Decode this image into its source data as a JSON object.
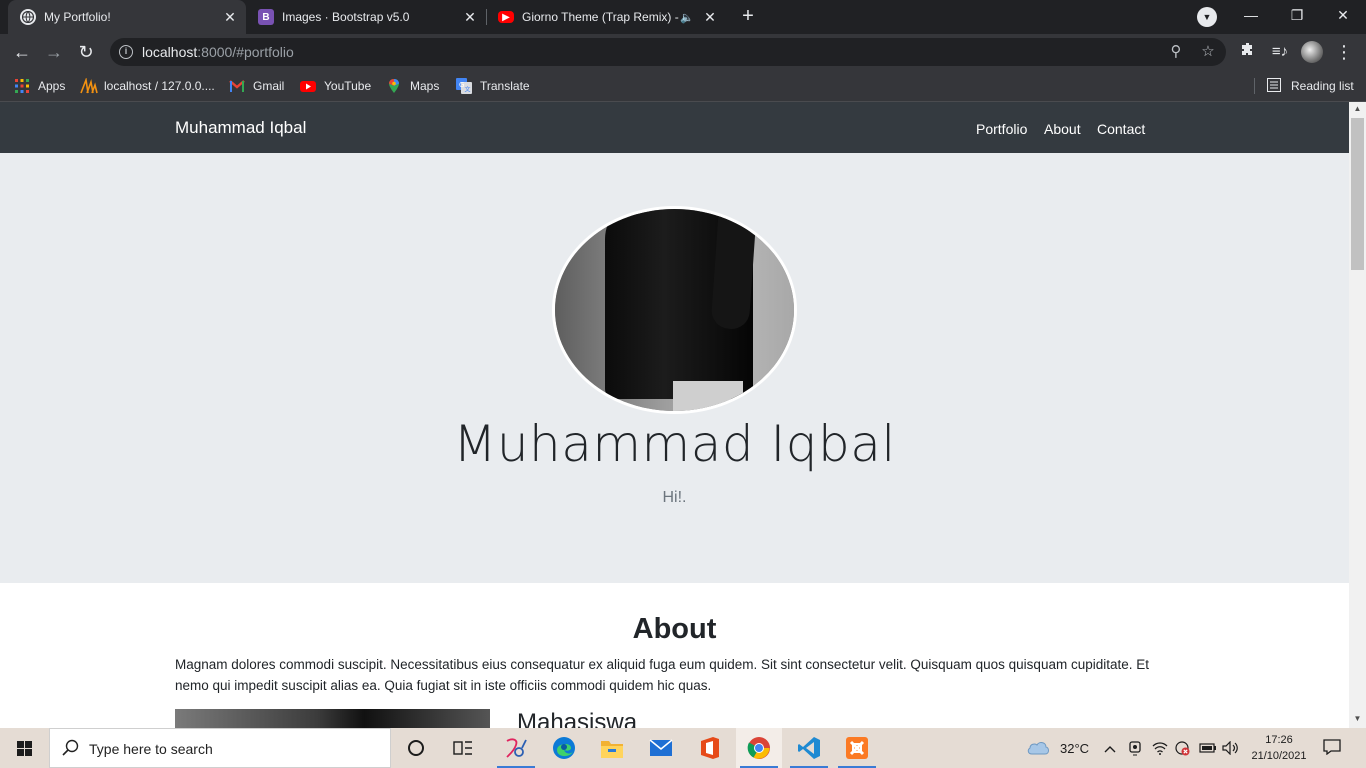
{
  "browser": {
    "tabs": [
      {
        "title": "My Portfolio!",
        "icon": "globe-icon",
        "active": true
      },
      {
        "title": "Images · Bootstrap v5.0",
        "icon": "bootstrap-icon",
        "active": false
      },
      {
        "title": "Giorno Theme (Trap Remix) -",
        "icon": "youtube-icon",
        "active": false,
        "audio": true
      }
    ],
    "new_tab": "+",
    "close_glyph": "✕",
    "url_host": "localhost",
    "url_rest": ":8000/#portfolio",
    "bookmarks": [
      {
        "label": "Apps",
        "icon": "apps-grid-icon"
      },
      {
        "label": "localhost / 127.0.0....",
        "icon": "phpmyadmin-icon"
      },
      {
        "label": "Gmail",
        "icon": "gmail-icon"
      },
      {
        "label": "YouTube",
        "icon": "youtube-icon"
      },
      {
        "label": "Maps",
        "icon": "maps-icon"
      },
      {
        "label": "Translate",
        "icon": "translate-icon"
      }
    ],
    "reading_list": "Reading list",
    "colors": {
      "frame": "#202124",
      "toolbar": "#35363a",
      "text": "#e8eaed"
    }
  },
  "site": {
    "brand": "Muhammad Iqbal",
    "nav": [
      "Portfolio",
      "About",
      "Contact"
    ],
    "hero": {
      "name": "Muhammad Iqbal",
      "subtitle": "Hi!."
    },
    "about": {
      "title": "About",
      "text": "Magnam dolores commodi suscipit. Necessitatibus eius consequatur ex aliquid fuga eum quidem. Sit sint consectetur velit. Quisquam quos quisquam cupiditate. Et nemo qui impedit suscipit alias ea. Quia fugiat sit in iste officiis commodi quidem hic quas.",
      "subtitle": "Mahasiswa"
    },
    "colors": {
      "navbar": "#343a40",
      "jumbotron": "#e9ecef"
    }
  },
  "taskbar": {
    "search_placeholder": "Type here to search",
    "apps": [
      "cortana-icon",
      "task-view-icon",
      "snipping-tool-icon",
      "edge-icon",
      "file-explorer-icon",
      "mail-icon",
      "office-icon",
      "chrome-icon",
      "vscode-icon",
      "xampp-icon"
    ],
    "weather": "32°C",
    "time": "17:26",
    "date": "21/10/2021"
  }
}
